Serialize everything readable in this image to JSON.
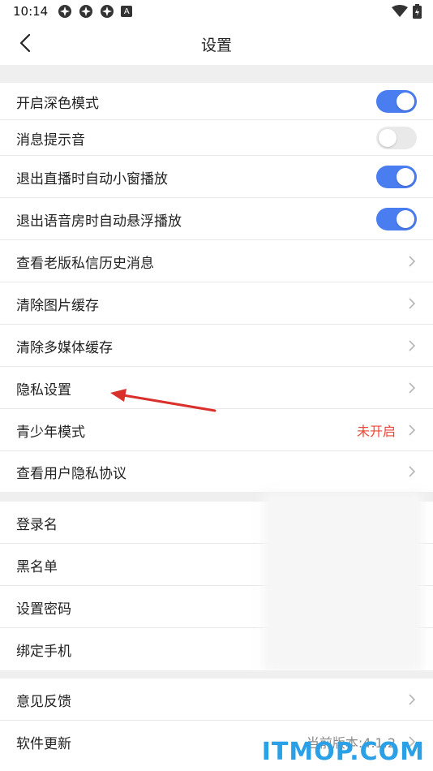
{
  "status_bar": {
    "time": "10:14",
    "icons": [
      "app-icon",
      "app-icon",
      "app-icon",
      "a-badge-icon"
    ],
    "a_badge": "A",
    "right_icons": [
      "wifi-icon",
      "battery-icon"
    ]
  },
  "header": {
    "title": "设置",
    "back_icon": "chevron-left-icon"
  },
  "settings_group_1": [
    {
      "label": "开启深色模式",
      "control": "toggle",
      "on": true
    },
    {
      "label": "消息提示音",
      "control": "toggle",
      "on": false
    },
    {
      "label": "退出直播时自动小窗播放",
      "control": "toggle",
      "on": true
    },
    {
      "label": "退出语音房时自动悬浮播放",
      "control": "toggle",
      "on": true
    },
    {
      "label": "查看老版私信历史消息",
      "control": "chevron"
    },
    {
      "label": "清除图片缓存",
      "control": "chevron"
    },
    {
      "label": "清除多媒体缓存",
      "control": "chevron"
    },
    {
      "label": "隐私设置",
      "control": "chevron"
    },
    {
      "label": "青少年模式",
      "control": "chevron",
      "value": "未开启",
      "value_color": "#e8483a"
    },
    {
      "label": "查看用户隐私协议",
      "control": "chevron"
    }
  ],
  "settings_group_2": [
    {
      "label": "登录名"
    },
    {
      "label": "黑名单"
    },
    {
      "label": "设置密码"
    },
    {
      "label": "绑定手机"
    }
  ],
  "settings_group_3": [
    {
      "label": "意见反馈",
      "control": "chevron"
    },
    {
      "label": "软件更新",
      "control": "chevron",
      "value": "当前版本:4.1.2"
    }
  ],
  "watermark": "ITMOP.COM",
  "colors": {
    "accent": "#4a7df0",
    "toggle_off": "#e9e9e9",
    "warning": "#e8483a",
    "annotation": "#d9302b",
    "watermark": "#2aa0e6"
  }
}
